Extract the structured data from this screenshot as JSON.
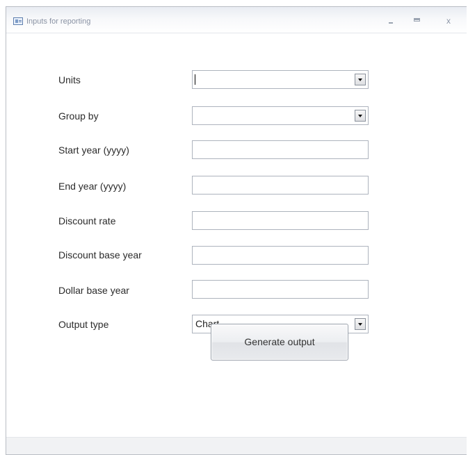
{
  "window": {
    "title": "Inputs for reporting",
    "controls": [
      "minimize-icon",
      "maximize-icon",
      "close-icon"
    ],
    "close_glyph": "x"
  },
  "form": {
    "fields": [
      {
        "label": "Units",
        "type": "combo",
        "value": ""
      },
      {
        "label": "Group by",
        "type": "combo",
        "value": ""
      },
      {
        "label": "Start year (yyyy)",
        "type": "text",
        "value": ""
      },
      {
        "label": "End year (yyyy)",
        "type": "text",
        "value": ""
      },
      {
        "label": "Discount rate",
        "type": "text",
        "value": ""
      },
      {
        "label": "Discount base year",
        "type": "text",
        "value": ""
      },
      {
        "label": "Dollar base year",
        "type": "text",
        "value": ""
      },
      {
        "label": "Output type",
        "type": "combo",
        "value": "Chart"
      }
    ],
    "generate_label": "Generate output"
  },
  "colors": {
    "field_border": "#adb3bd",
    "label_text": "#2b2b2b",
    "title_text": "#8a93a4"
  }
}
